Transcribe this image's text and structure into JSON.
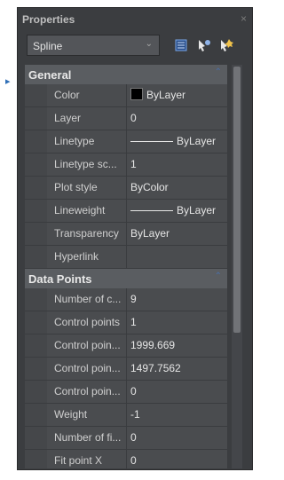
{
  "panel": {
    "title": "Properties",
    "close_symbol": "×"
  },
  "selector": {
    "value": "Spline"
  },
  "toolbar": {
    "quick_select_icon": "quick-select-icon",
    "select_objects_icon": "select-objects-icon",
    "toggle_pickadd_icon": "toggle-pickadd-icon"
  },
  "sections": [
    {
      "title": "General",
      "rows": [
        {
          "name": "Color",
          "value": "ByLayer",
          "swatch": "#000000"
        },
        {
          "name": "Layer",
          "value": "0"
        },
        {
          "name": "Linetype",
          "value": "ByLayer",
          "line": true
        },
        {
          "name": "Linetype sc...",
          "value": "1"
        },
        {
          "name": "Plot style",
          "value": "ByColor"
        },
        {
          "name": "Lineweight",
          "value": "ByLayer",
          "line": true
        },
        {
          "name": "Transparency",
          "value": "ByLayer"
        },
        {
          "name": "Hyperlink",
          "value": ""
        }
      ]
    },
    {
      "title": "Data Points",
      "rows": [
        {
          "name": "Number of c...",
          "value": "9"
        },
        {
          "name": "Control points",
          "value": "1"
        },
        {
          "name": "Control poin...",
          "value": "1999.669"
        },
        {
          "name": "Control poin...",
          "value": "1497.7562"
        },
        {
          "name": "Control poin...",
          "value": "0"
        },
        {
          "name": "Weight",
          "value": "-1"
        },
        {
          "name": "Number of fi...",
          "value": "0"
        },
        {
          "name": "Fit point X",
          "value": "0"
        }
      ]
    }
  ],
  "colors": {
    "panel_bg": "#3b3d40",
    "section_bg": "#5a5d61",
    "accent": "#4a6ea7"
  }
}
